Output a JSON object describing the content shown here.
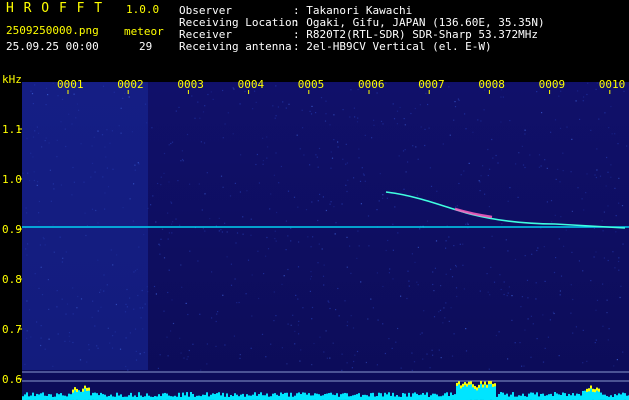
{
  "header": {
    "title": "H R O F F T",
    "version": "1.0.0",
    "filename": "2509250000.png",
    "timestamp": "25.09.25 00:00",
    "meteor_label": "meteor",
    "meteor_count": "29",
    "observer_label": "Observer",
    "observer_value": ": Takanori Kawachi",
    "location_label": "Receiving Location",
    "location_value": ": Ogaki, Gifu, JAPAN (136.60E, 35.35N)",
    "receiver_label": "Receiver",
    "receiver_value": ": R820T2(RTL-SDR) SDR-Sharp 53.372MHz",
    "antenna_label": "Receiving antenna",
    "antenna_value": ": 2el-HB9CV Vertical (el. E-W)"
  },
  "spectrogram": {
    "y_unit": "kHz",
    "y_ticks": [
      "1.1",
      "1.0",
      "0.9",
      "0.8",
      "0.7",
      "0.6"
    ],
    "x_ticks": [
      "0001",
      "0002",
      "0003",
      "0004",
      "0005",
      "0006",
      "0007",
      "0008",
      "0009",
      "0010"
    ],
    "carrier_khz": 0.905,
    "colors": {
      "background": "#0a0a5a",
      "noise": "#1a2aa0",
      "carrier": "#00e5ff",
      "trace": "#40ffe0",
      "hot": "#ff60c0",
      "bars": "#00e5ff",
      "peaks": "#ffff00"
    }
  }
}
